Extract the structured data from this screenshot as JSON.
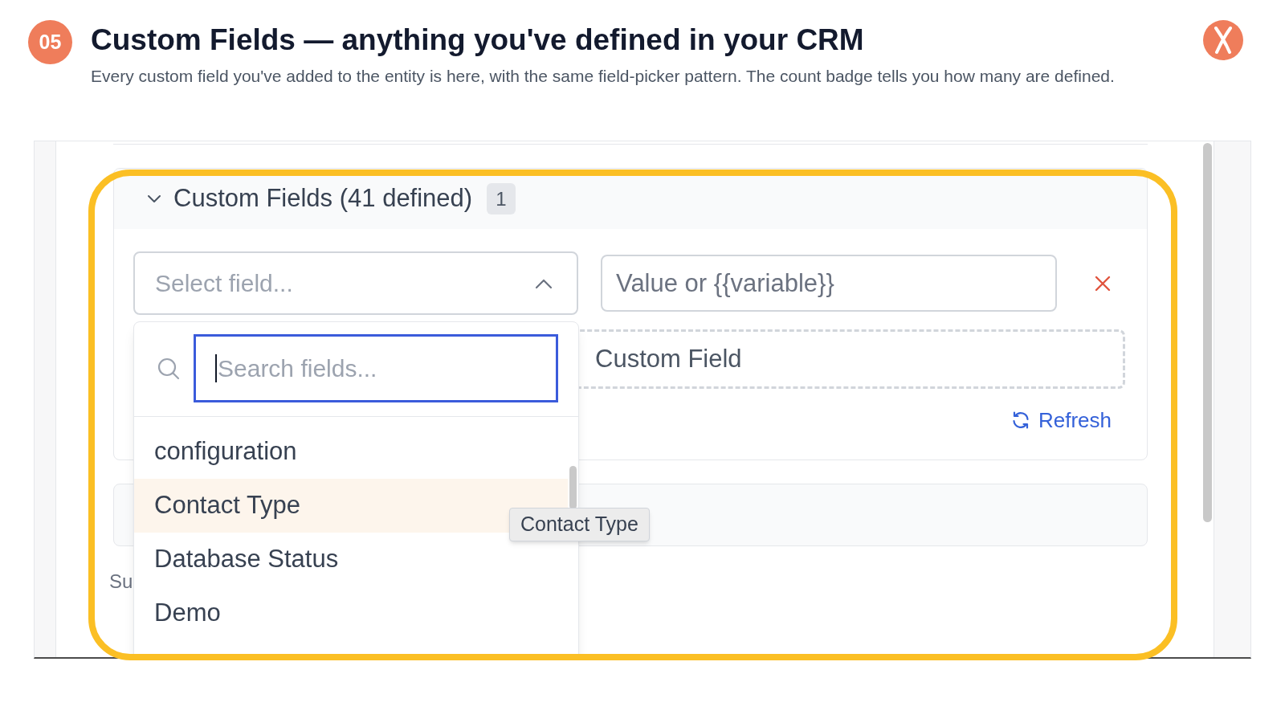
{
  "step_badge": "05",
  "title": "Custom Fields — anything you've defined in your CRM",
  "subtitle": "Every custom field you've added to the entity is here, with the same field-picker pattern. The count badge tells you how many are defined.",
  "screenshot": {
    "section": {
      "title": "Custom Fields (41 defined)",
      "count_badge": "1",
      "expanded": true,
      "field_select": {
        "placeholder": "Select field...",
        "open": true
      },
      "value_input": {
        "placeholder": "Value or {{variable}}"
      },
      "add_button": "Custom Field",
      "refresh_link": "Refresh"
    },
    "partial_label": "Su",
    "dropdown": {
      "search": {
        "placeholder": "Search fields..."
      },
      "options": [
        {
          "label": "configuration",
          "selected": false
        },
        {
          "label": "Contact Type",
          "selected": true
        },
        {
          "label": "Database Status",
          "selected": false
        },
        {
          "label": "Demo",
          "selected": false
        }
      ]
    },
    "tooltip": "Contact Type"
  }
}
